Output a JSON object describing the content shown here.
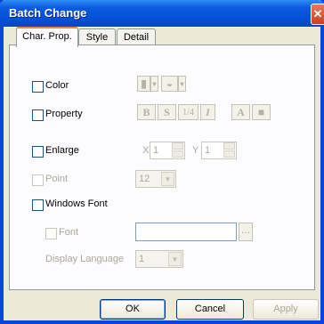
{
  "window": {
    "title": "Batch Change",
    "close_glyph": "✕"
  },
  "tabs": [
    "Char. Prop.",
    "Style",
    "Detail"
  ],
  "options": {
    "color_label": "Color",
    "property_label": "Property",
    "enlarge_label": "Enlarge",
    "point_label": "Point",
    "windows_font_label": "Windows Font",
    "font_label": "Font",
    "display_language_label": "Display Language"
  },
  "property_buttons": [
    "B",
    "S",
    "1/4",
    "I",
    "A",
    "■"
  ],
  "enlarge": {
    "x_label": "X",
    "x_value": "1",
    "y_label": "Y",
    "y_value": "1"
  },
  "point_value": "12",
  "font_browse": "...",
  "display_language_value": "1",
  "buttons": {
    "ok": "OK",
    "cancel": "Cancel",
    "apply": "Apply"
  }
}
